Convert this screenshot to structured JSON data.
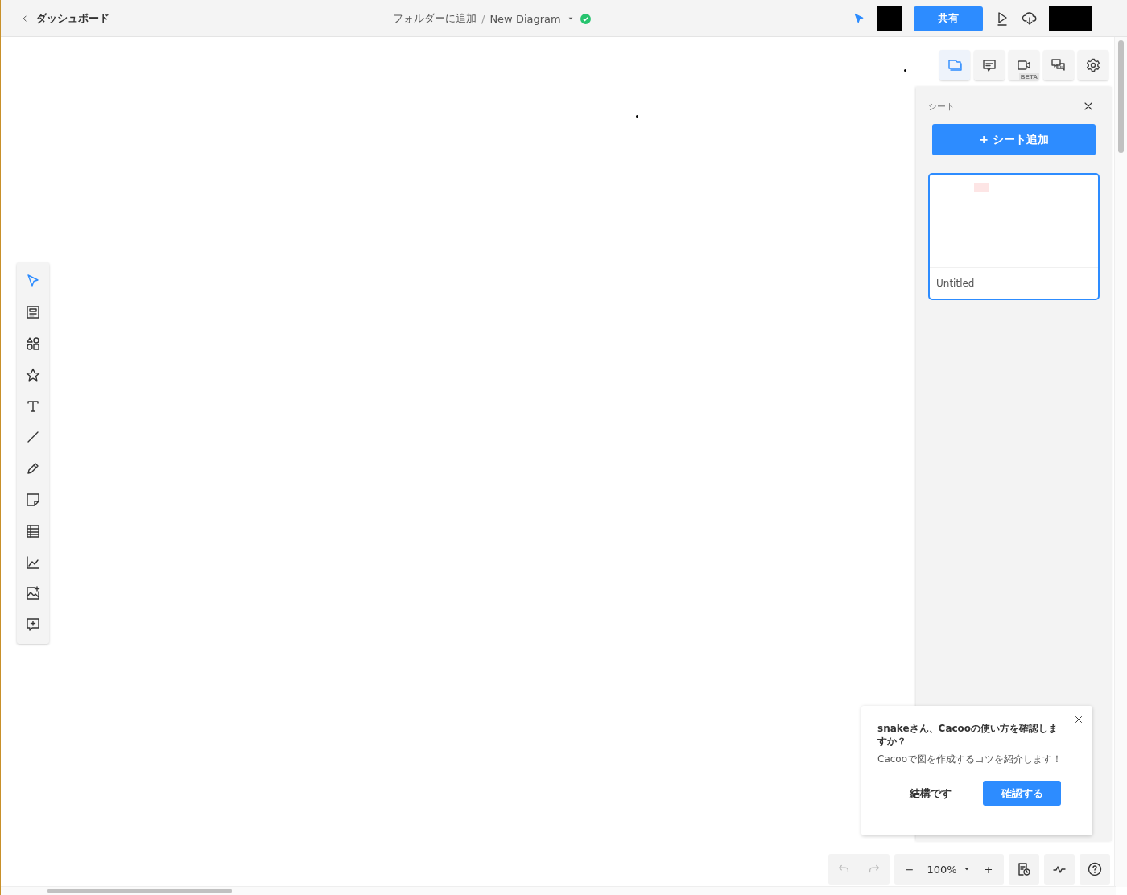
{
  "top_bar": {
    "back_label": "ダッシュボード",
    "folder_link": "フォルダーに追加",
    "separator": "/",
    "diagram_name": "New Diagram",
    "saved": true,
    "share_button": "共有"
  },
  "panel_tabs": [
    {
      "kind": "sheets",
      "selected": true
    },
    {
      "kind": "comments",
      "selected": false
    },
    {
      "kind": "video",
      "badge": "BETA",
      "selected": false
    },
    {
      "kind": "chat",
      "selected": false
    },
    {
      "kind": "settings",
      "selected": false
    }
  ],
  "sheet_panel": {
    "title": "シート",
    "add_button": "+ シート追加",
    "sheets": [
      {
        "name": "Untitled",
        "selected": true
      }
    ]
  },
  "tools": [
    {
      "kind": "select",
      "selected": true
    },
    {
      "kind": "template",
      "selected": false
    },
    {
      "kind": "shapes",
      "selected": false
    },
    {
      "kind": "star",
      "selected": false
    },
    {
      "kind": "text",
      "selected": false
    },
    {
      "kind": "line",
      "selected": false
    },
    {
      "kind": "pencil",
      "selected": false
    },
    {
      "kind": "sticky",
      "selected": false
    },
    {
      "kind": "table",
      "selected": false
    },
    {
      "kind": "chart",
      "selected": false
    },
    {
      "kind": "image",
      "selected": false
    },
    {
      "kind": "comment",
      "selected": false
    }
  ],
  "popup": {
    "title": "snakeさん、Cacooの使い方を確認しますか？",
    "message": "Cacooで図を作成するコツを紹介します！",
    "dismiss_button": "結構です",
    "confirm_button": "確認する"
  },
  "bottom_bar": {
    "undo_disabled": true,
    "redo_disabled": true,
    "zoom_out": "−",
    "zoom_level": "100%",
    "zoom_in": "+"
  }
}
